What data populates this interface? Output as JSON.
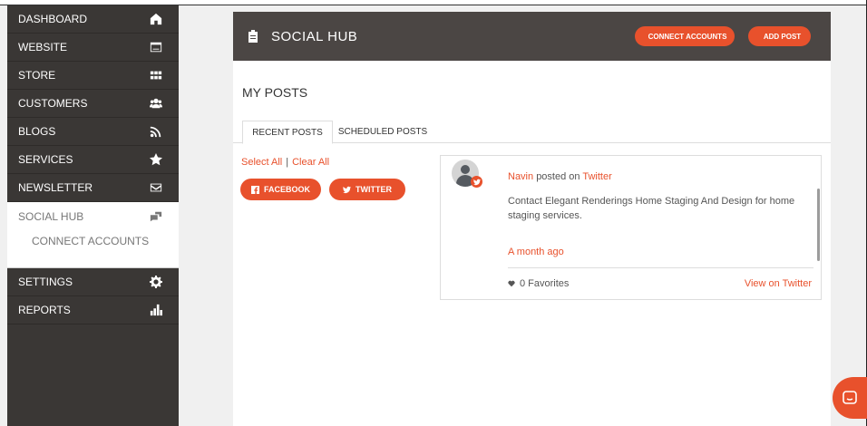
{
  "sidebar": {
    "items": [
      {
        "label": "DASHBOARD",
        "icon": "home-icon"
      },
      {
        "label": "WEBSITE",
        "icon": "browser-icon"
      },
      {
        "label": "STORE",
        "icon": "grid-icon"
      },
      {
        "label": "CUSTOMERS",
        "icon": "users-icon"
      },
      {
        "label": "BLOGS",
        "icon": "rss-icon"
      },
      {
        "label": "SERVICES",
        "icon": "star-icon"
      },
      {
        "label": "NEWSLETTER",
        "icon": "envelope-icon"
      },
      {
        "label": "SOCIAL HUB",
        "icon": "chat-bubbles-icon",
        "active": true
      },
      {
        "label": "CONNECT ACCOUNTS",
        "submenu": true
      },
      {
        "label": "SETTINGS",
        "icon": "gear-icon"
      },
      {
        "label": "REPORTS",
        "icon": "bar-chart-icon"
      }
    ]
  },
  "header": {
    "title": "SOCIAL HUB",
    "connect_label": "CONNECT ACCOUNTS",
    "add_label": "ADD POST"
  },
  "main": {
    "section_title": "MY POSTS",
    "tabs": [
      {
        "label": "RECENT POSTS",
        "active": true
      },
      {
        "label": "SCHEDULED POSTS",
        "active": false
      }
    ],
    "select_all": "Select All",
    "separator": "|",
    "clear_all": "Clear All",
    "filters": {
      "facebook": "FACEBOOK",
      "twitter": "TWITTER"
    }
  },
  "post": {
    "author": "Navin",
    "posted_on": "posted on",
    "network": "Twitter",
    "text": "Contact Elegant Renderings Home Staging And Design for home staging services.",
    "time": "A month ago",
    "favorites": "0 Favorites",
    "view_link": "View on Twitter"
  },
  "colors": {
    "accent": "#e8512c",
    "sidebar_bg": "#3a3735",
    "header_bg": "#4b4644"
  }
}
